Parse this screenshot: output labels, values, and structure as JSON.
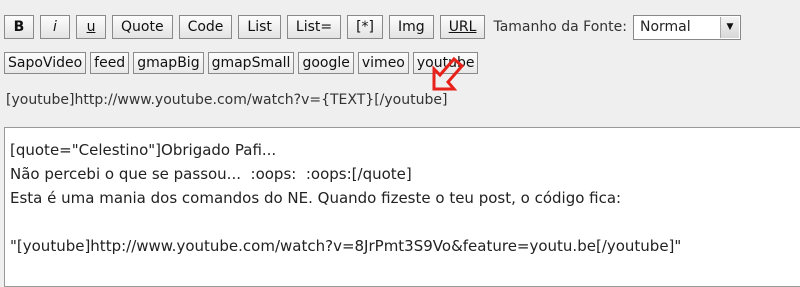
{
  "toolbar": {
    "bold": "B",
    "italic": "i",
    "underline": "u",
    "quote": "Quote",
    "code": "Code",
    "list": "List",
    "list_eq": "List=",
    "list_item": "[*]",
    "img": "Img",
    "url": "URL",
    "font_size_label": "Tamanho da Fonte:",
    "font_size_value": "Normal"
  },
  "embed_buttons": [
    "SapoVideo",
    "feed",
    "gmapBig",
    "gmapSmall",
    "google",
    "vimeo",
    "youtube"
  ],
  "hint": "[youtube]http://www.youtube.com/watch?v={TEXT}[/youtube]",
  "editor": {
    "lines": [
      "[quote=\"Celestino\"]Obrigado Pafi...",
      "Não percebi o que se passou...  :oops:  :oops:[/quote]",
      "Esta é uma mania dos comandos do NE. Quando fizeste o teu post, o código fica:",
      "",
      "\"[youtube]http://www.youtube.com/watch?v=8JrPmt3S9Vo&feature=youtu.be[/youtube]\""
    ]
  },
  "colors": {
    "annotation_arrow": "#e8221a"
  },
  "icons": {
    "annotation": "arrow-icon",
    "dropdown": "chevron-down-icon"
  }
}
